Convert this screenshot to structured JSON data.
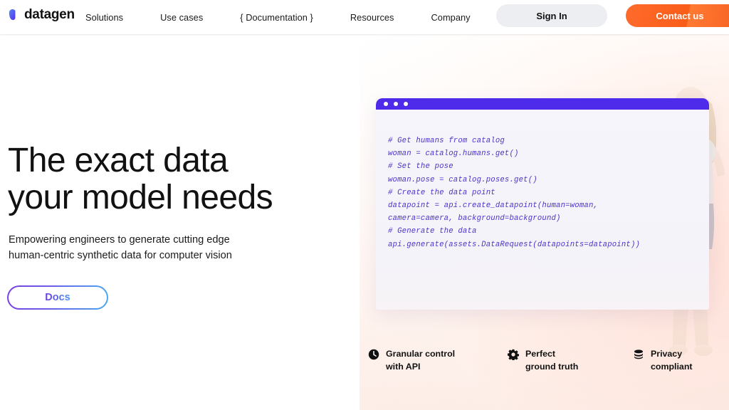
{
  "header": {
    "logo": {
      "icon": "datagen-droplet-logo",
      "text": "datagen"
    },
    "nav": [
      {
        "label": "Solutions"
      },
      {
        "label": "Use cases"
      },
      {
        "label": "{ Documentation }"
      },
      {
        "label": "Resources"
      },
      {
        "label": "Company"
      }
    ],
    "sign_in_label": "Sign In",
    "contact_label": "Contact us",
    "contact_color": "#F95D18",
    "sign_in_bg": "#ECEEF2"
  },
  "hero": {
    "headline": "The exact data\nyour model needs",
    "subhead": "Empowering engineers to generate cutting edge\nhuman-centric synthetic data for computer vision",
    "docs_label": "Docs",
    "docs_gradient_from": "#7B3FE4",
    "docs_gradient_to": "#4AA8F0"
  },
  "code_window": {
    "titlebar_color": "#4E2BEA",
    "dots": 3,
    "code_color": "#4A34C8",
    "lines": [
      "# Get humans from catalog",
      "woman = catalog.humans.get()",
      "# Set the pose",
      "woman.pose = catalog.poses.get()",
      "# Create the data point",
      "datapoint = api.create_datapoint(human=woman,",
      "camera=camera, background=background)",
      "# Generate the data",
      "api.generate(assets.DataRequest(datapoints=datapoint))"
    ]
  },
  "features": [
    {
      "icon": "clock-icon",
      "label": "Granular control\nwith API"
    },
    {
      "icon": "gear-icon",
      "label": "Perfect\nground truth"
    },
    {
      "icon": "database-icon",
      "label": "Privacy\ncompliant"
    }
  ]
}
